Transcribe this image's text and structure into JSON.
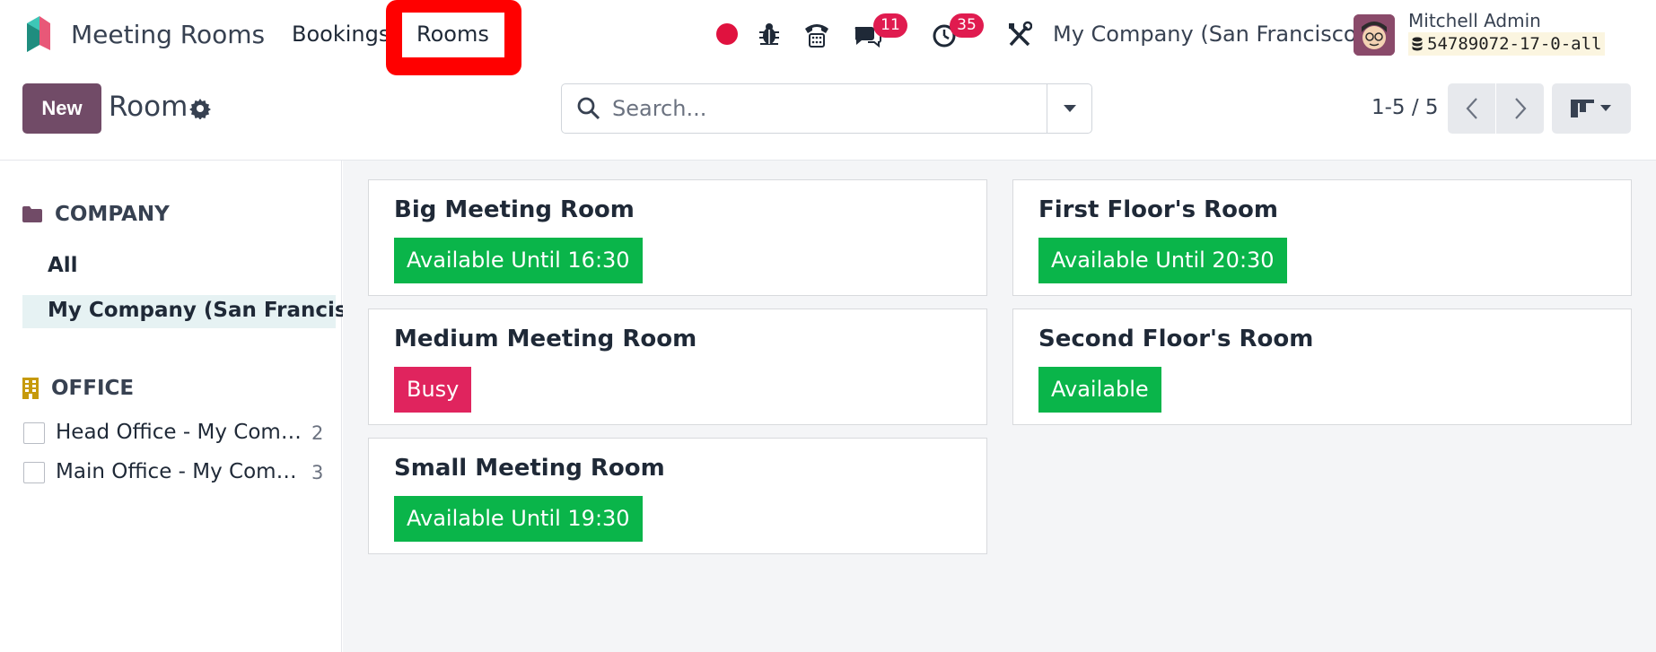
{
  "navbar": {
    "app_title": "Meeting Rooms",
    "menu": {
      "bookings_label": "Bookings",
      "rooms_label": "Rooms"
    },
    "chat_badge": "11",
    "activity_badge": "35",
    "company": "My Company (San Francisco)",
    "user_name": "Mitchell Admin",
    "database": "54789072-17-0-all"
  },
  "control_panel": {
    "new_label": "New",
    "title": "Room",
    "search_placeholder": "Search...",
    "pager": "1-5 / 5"
  },
  "search_panel": {
    "company_header": "COMPANY",
    "company_items": [
      "All",
      "My Company (San Francisco)"
    ],
    "office_header": "OFFICE",
    "offices": [
      {
        "label": "Head Office - My Company (San Francisco)",
        "count": "2"
      },
      {
        "label": "Main Office - My Company (San Francisco)",
        "count": "3"
      }
    ]
  },
  "rooms": [
    {
      "name": "Big Meeting Room",
      "status": "Available Until 16:30"
    },
    {
      "name": "First Floor's Room",
      "status": "Available Until 20:30"
    },
    {
      "name": "Medium Meeting Room",
      "status": "Busy"
    },
    {
      "name": "Second Floor's Room",
      "status": "Available"
    },
    {
      "name": "Small Meeting Room",
      "status": "Available Until 19:30"
    }
  ],
  "colors": {
    "brand": "#714b67",
    "available": "#0ab54a",
    "busy": "#e0245e",
    "highlight": "#ff0000"
  },
  "icons": [
    "app-logo",
    "record-icon",
    "bug-icon",
    "phone-icon",
    "chat-icon",
    "activity-clock-icon",
    "tools-icon",
    "database-icon",
    "gear-icon",
    "search-icon",
    "caret-down-icon",
    "chevron-left-icon",
    "chevron-right-icon",
    "kanban-view-icon",
    "folder-icon",
    "building-icon"
  ]
}
